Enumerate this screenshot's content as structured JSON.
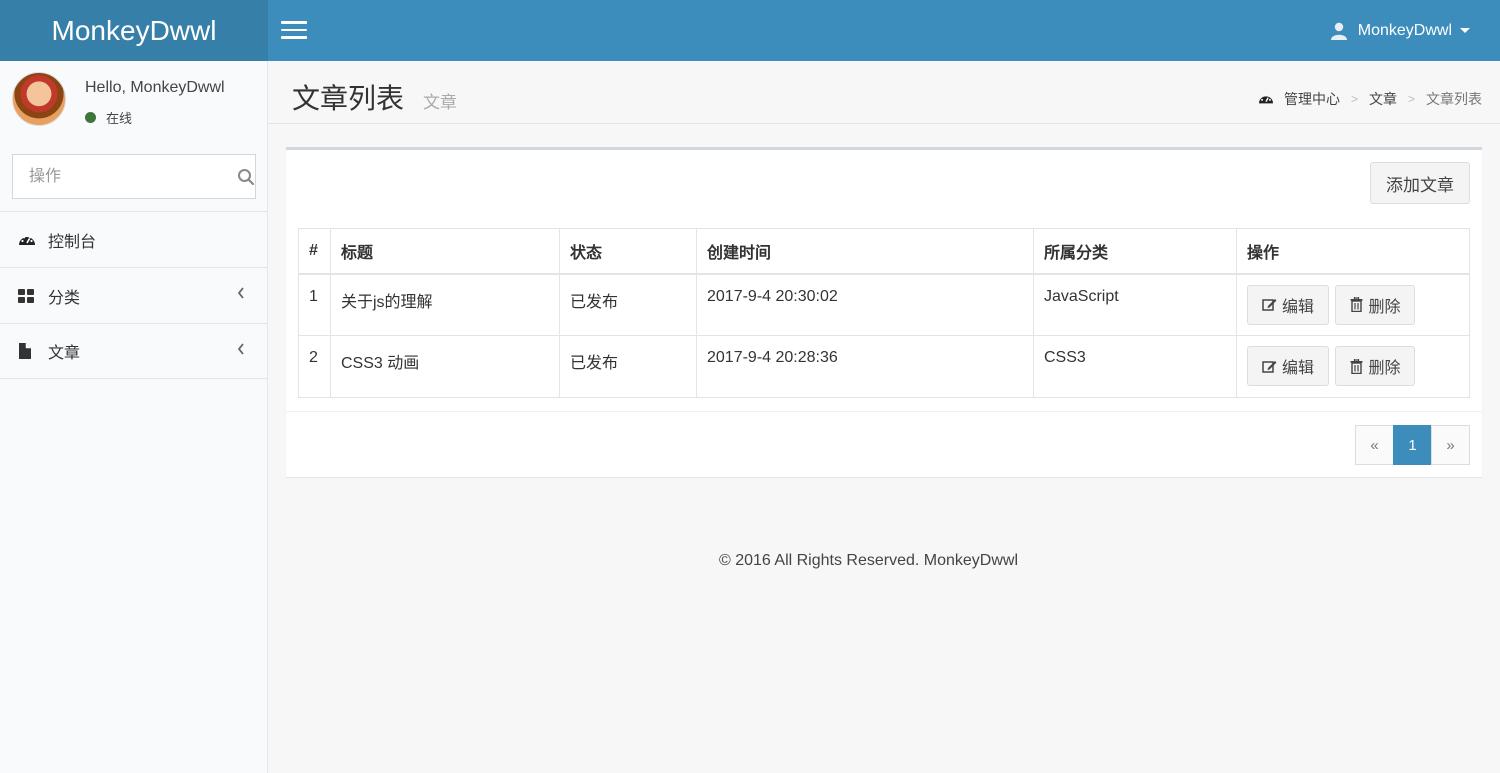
{
  "header": {
    "logo": "MonkeyDwwl",
    "user_name": "MonkeyDwwl"
  },
  "sidebar": {
    "greeting": "Hello, MonkeyDwwl",
    "status": "在线",
    "status_color": "#3c763d",
    "search_placeholder": "操作",
    "items": [
      {
        "label": "控制台",
        "icon": "dashboard-icon"
      },
      {
        "label": "分类",
        "icon": "grid-icon",
        "expandable": true
      },
      {
        "label": "文章",
        "icon": "file-icon",
        "expandable": true
      }
    ]
  },
  "content_header": {
    "title": "文章列表",
    "subtitle": "文章",
    "breadcrumb": [
      "管理中心",
      "文章",
      "文章列表"
    ]
  },
  "box": {
    "add_button": "添加文章",
    "columns": [
      "#",
      "标题",
      "状态",
      "创建时间",
      "所属分类",
      "操作"
    ],
    "rows": [
      {
        "num": "1",
        "title": "关于js的理解",
        "status": "已发布",
        "created": "2017-9-4 20:30:02",
        "category": "JavaScript"
      },
      {
        "num": "2",
        "title": "CSS3 动画",
        "status": "已发布",
        "created": "2017-9-4 20:28:36",
        "category": "CSS3"
      }
    ],
    "edit_label": "编辑",
    "delete_label": "删除",
    "pagination": {
      "prev": "«",
      "current": "1",
      "next": "»"
    }
  },
  "footer": {
    "copyright": "© 2016 All Rights Reserved. MonkeyDwwl"
  },
  "colors": {
    "header": "#3c8dbc",
    "logo_bg": "#367fa9"
  }
}
